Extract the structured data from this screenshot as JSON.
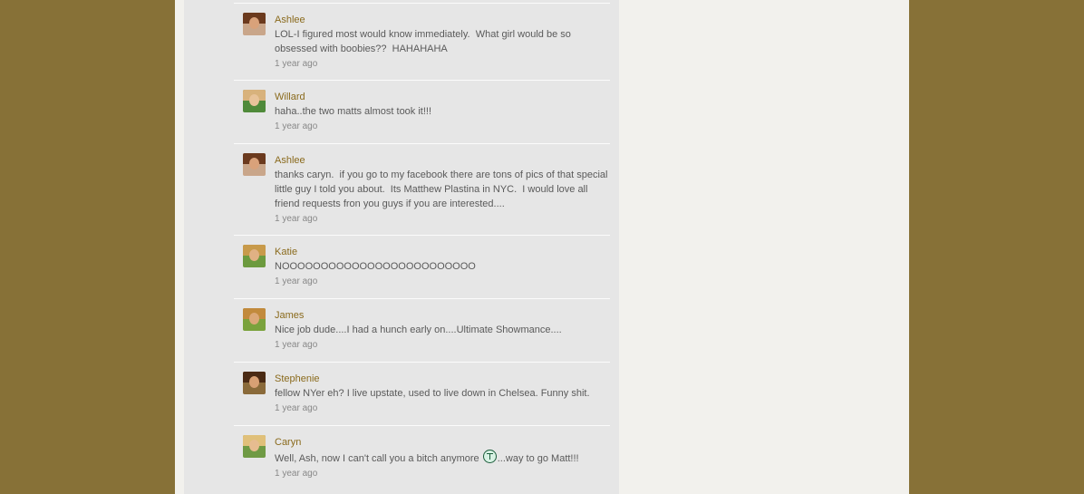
{
  "comments": [
    {
      "author": "Ashlee",
      "text": "LOL-I figured most would know immediately.  What girl would be so obsessed with boobies??  HAHAHAHA",
      "time": "1 year ago",
      "avatar": {
        "bg": "#c9a68a",
        "hair": "#6b3a1e",
        "skin": "#d9a27a"
      }
    },
    {
      "author": "Willard",
      "text": "haha..the two matts almost took it!!!",
      "time": "1 year ago",
      "avatar": {
        "bg": "#4f8a3a",
        "hair": "#d8b27c",
        "skin": "#e8c39a"
      }
    },
    {
      "author": "Ashlee",
      "text": "thanks caryn.  if you go to my facebook there are tons of pics of that special little guy I told you about.  Its Matthew Plastina in NYC.  I would love all friend requests fron you guys if you are interested....",
      "time": "1 year ago",
      "avatar": {
        "bg": "#c9a68a",
        "hair": "#6b3a1e",
        "skin": "#d9a27a"
      }
    },
    {
      "author": "Katie",
      "text": "NOOOOOOOOOOOOOOOOOOOOOOOOO",
      "time": "1 year ago",
      "avatar": {
        "bg": "#6c9a3e",
        "hair": "#c89a4a",
        "skin": "#e0b184"
      }
    },
    {
      "author": "James",
      "text": "Nice job dude....I had a hunch early on....Ultimate Showmance....",
      "time": "1 year ago",
      "avatar": {
        "bg": "#7aa23c",
        "hair": "#c28a3c",
        "skin": "#dca878"
      }
    },
    {
      "author": "Stephenie",
      "text": "fellow NYer eh? I live upstate, used to live down in Chelsea. Funny shit.",
      "time": "1 year ago",
      "avatar": {
        "bg": "#8a6a3a",
        "hair": "#4a2a14",
        "skin": "#d8a074"
      }
    },
    {
      "author": "Caryn",
      "text_before": "Well, Ash, now I can't call you a bitch anymore ",
      "text_after": "...way to go Matt!!!",
      "emoticon": "smiley-icon",
      "time": "1 year ago",
      "avatar": {
        "bg": "#6f9a44",
        "hair": "#e0c07a",
        "skin": "#e6bc90"
      }
    }
  ]
}
